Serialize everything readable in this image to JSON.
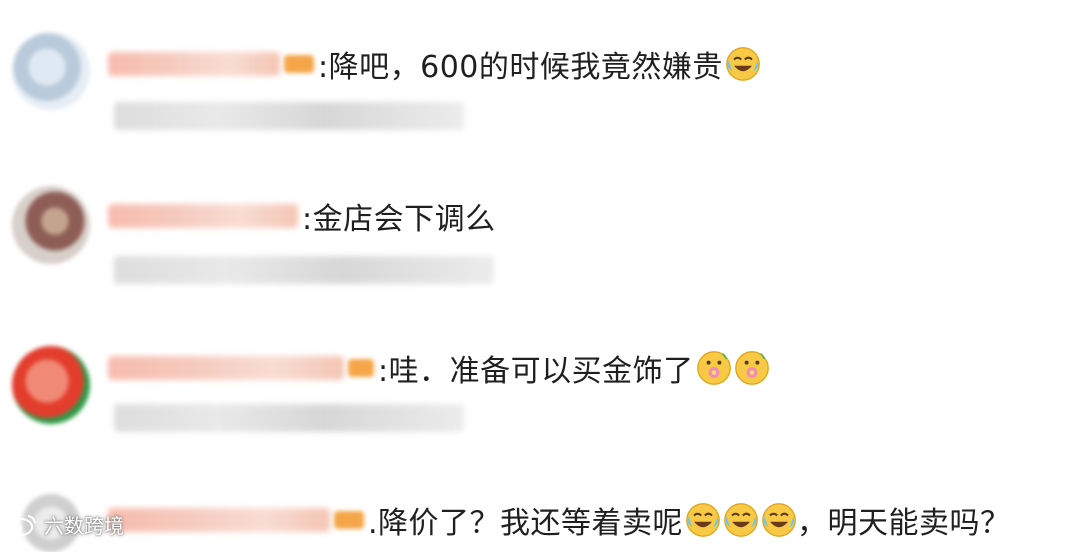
{
  "comments": [
    {
      "text": ":降吧，600的时候我竟然嫌贵",
      "emoji": [
        "laugh-cry-icon"
      ]
    },
    {
      "text": ":金店会下调么",
      "emoji": []
    },
    {
      "text": ":哇．准备可以买金饰了",
      "emoji": [
        "flower-smile-icon",
        "flower-smile-icon"
      ]
    },
    {
      "text": ".降价了？我还等着卖呢",
      "emoji": [
        "laugh-cry-icon",
        "laugh-cry-icon",
        "laugh-cry-icon"
      ],
      "text_after": "，明天能卖吗？"
    }
  ],
  "watermark": {
    "icon": "weibo-logo-icon",
    "text": "六数跨境"
  },
  "colors": {
    "text": "#1f1f1f",
    "name_blur": "#f5c5b7",
    "badge": "#f5a649",
    "meta_blur": "#dddddd"
  }
}
